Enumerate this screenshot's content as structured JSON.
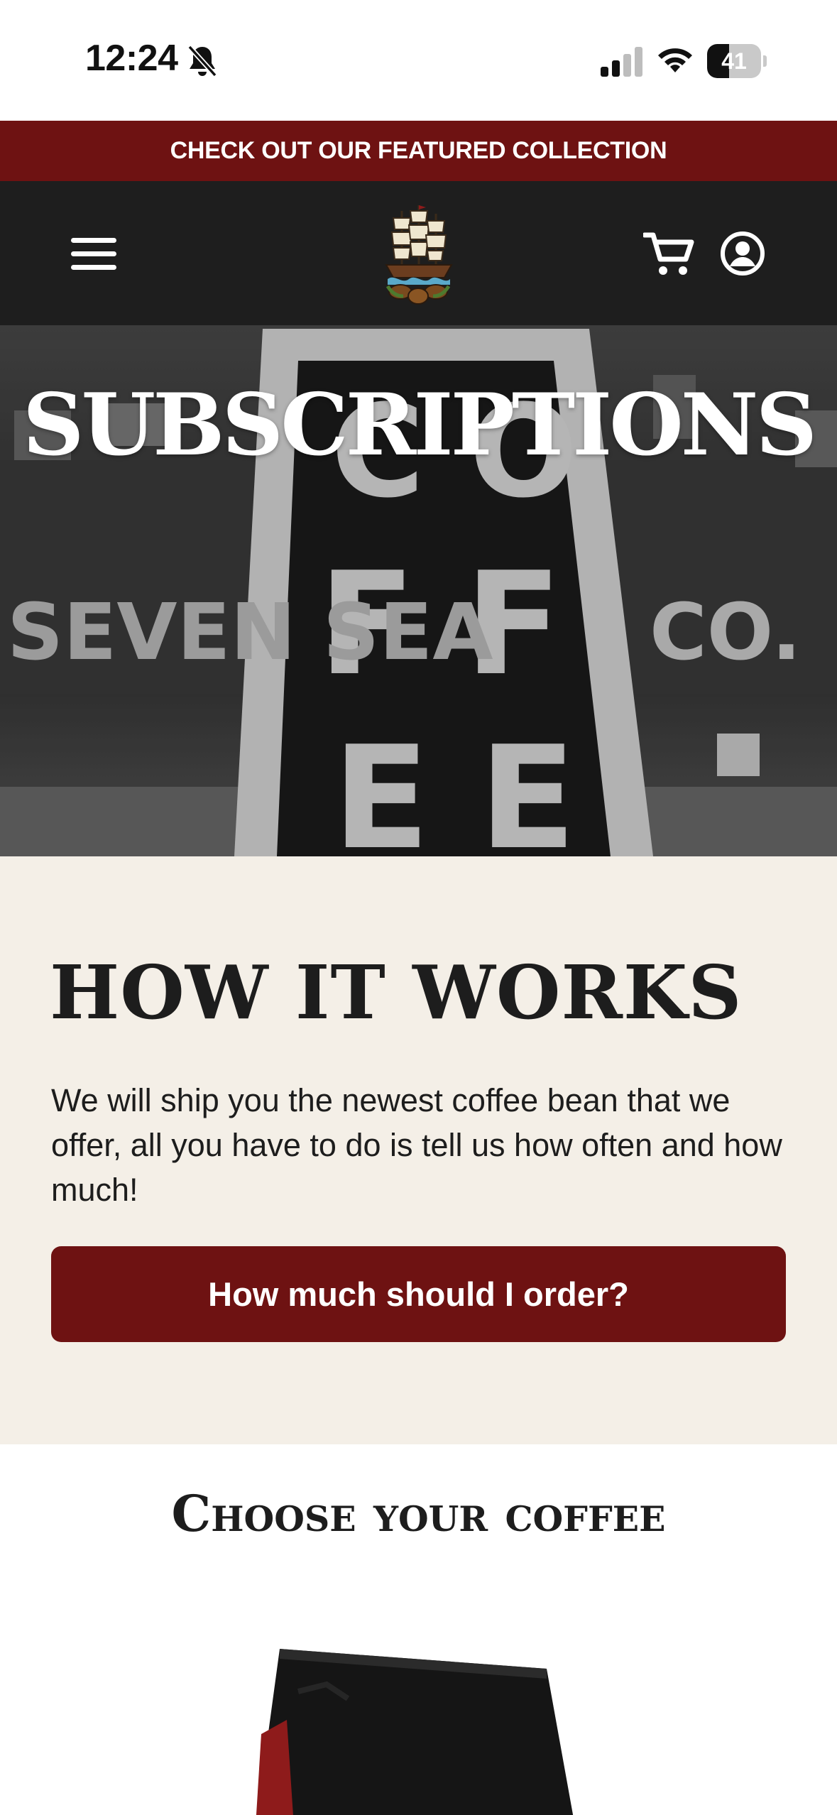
{
  "status_bar": {
    "time": "12:24",
    "battery_level": "41",
    "battery_fraction": 0.41,
    "icons": [
      "bell-slash-icon",
      "cellular-signal-icon",
      "wifi-icon",
      "battery-icon"
    ]
  },
  "announcement": {
    "text": "CHECK OUT OUR FEATURED COLLECTION"
  },
  "header": {
    "icons": [
      "menu-icon",
      "ship-logo",
      "cart-icon",
      "account-icon"
    ]
  },
  "hero": {
    "title": "SUBSCRIPTIONS"
  },
  "how_it_works": {
    "title": "HOW IT WORKS",
    "body": "We will ship you the newest coffee bean that we offer, all you have to do is tell us how often and how much!",
    "button_label": "How much should I order?"
  },
  "choose": {
    "title": "Choose your coffee"
  },
  "colors": {
    "brand_red": "#6e1212",
    "header_dark": "#1e1e1e",
    "section_cream": "#f4efe7"
  }
}
